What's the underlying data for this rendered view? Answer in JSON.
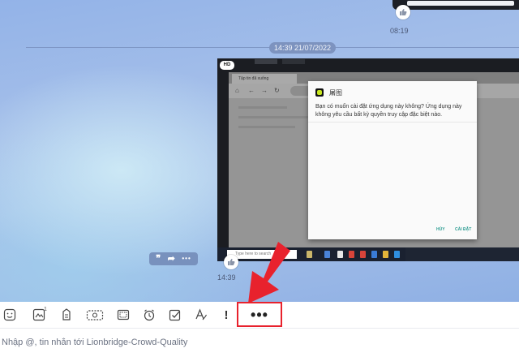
{
  "messages": {
    "previous": {
      "time": "08:19"
    },
    "date_separator": "14:39 21/07/2022",
    "screenshot": {
      "badge": "HD",
      "time": "14:39",
      "browser_tab": "Tập tin đã xuống",
      "taskbar_search": "Type here to search",
      "dialog": {
        "app_name": "屠图",
        "message": "Bạn có muốn cài đặt ứng dụng này không? Ứng dụng này không yêu cầu bất kỳ quyền truy cập đặc biệt nào.",
        "cancel": "HỦY",
        "install": "CÀI ĐẶT"
      }
    },
    "hover_actions": {
      "quote": "❞",
      "forward": "➦",
      "more": "•••"
    }
  },
  "toolbar": {
    "sticker_badge": "1",
    "more_label": "•••",
    "important_label": "!"
  },
  "composer": {
    "placeholder": "Nhập @, tin nhắn tới Lionbridge-Crowd-Quality"
  },
  "colors": {
    "annotation": "#e8222d",
    "dialog_button": "#2f9d93",
    "date_pill": "#7d93bf"
  },
  "icons": [
    "emoji-icon",
    "sticker-icon",
    "image-icon",
    "attachment-icon",
    "screenshot-icon",
    "reminder-icon",
    "task-icon",
    "format-icon",
    "important-icon",
    "more-icon",
    "like-icon",
    "quote-icon",
    "forward-icon"
  ]
}
